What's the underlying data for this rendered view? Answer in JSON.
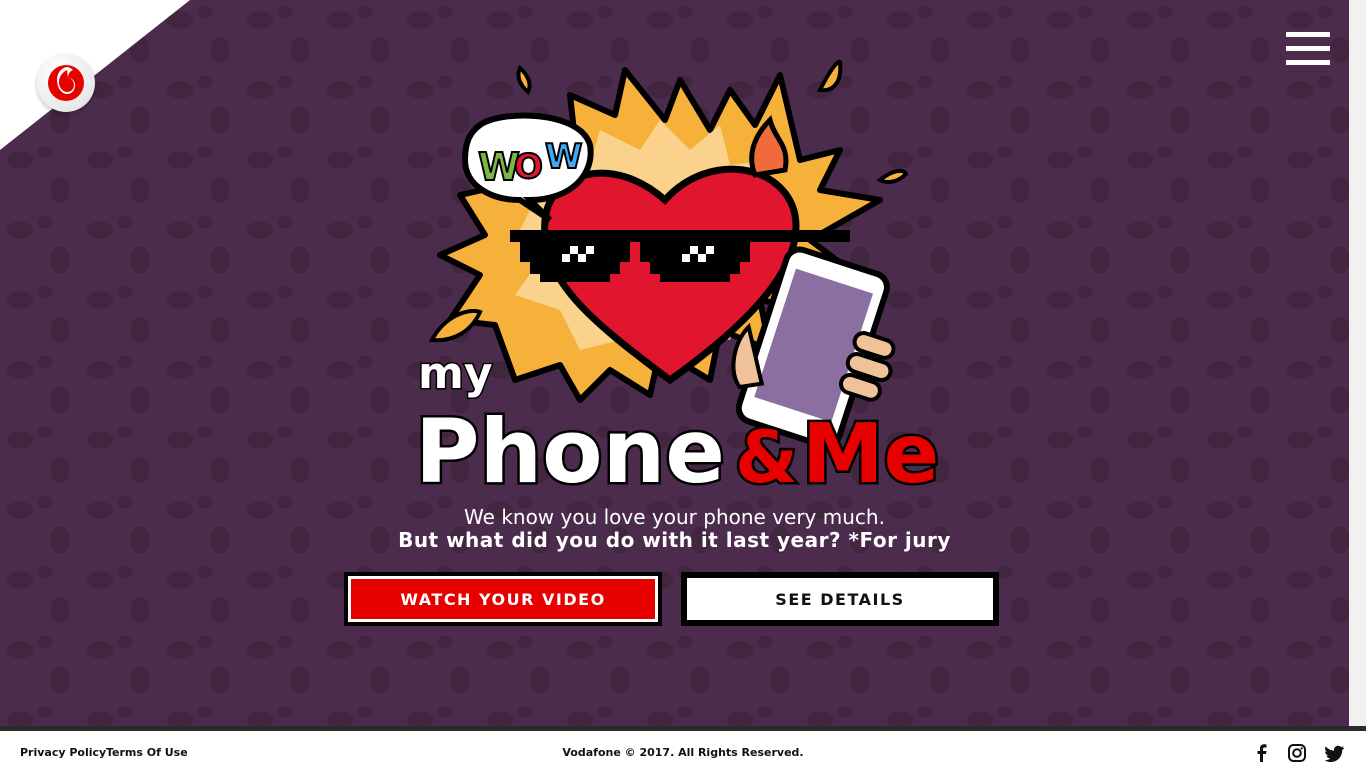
{
  "brand": {
    "name": "Vodafone"
  },
  "header": {
    "menu_icon": "hamburger-menu-icon"
  },
  "hero": {
    "bubble_text": "WOW",
    "title_my": "my",
    "title_phone": "Phone",
    "title_amp": "&",
    "title_me": "Me",
    "tagline_line1": "We know you love your phone very much.",
    "tagline_line2": "But what did you do with it last year? *For jury"
  },
  "actions": {
    "watch_label": "WATCH YOUR VIDEO",
    "details_label": "SEE DETAILS"
  },
  "footer": {
    "privacy_label": "Privacy Policy",
    "terms_label": "Terms Of Use",
    "copyright": "Vodafone © 2017. All Rights Reserved.",
    "social_icons": [
      "facebook-icon",
      "instagram-icon",
      "twitter-icon"
    ]
  },
  "colors": {
    "background": "#4b2c4d",
    "accent_red": "#e60000",
    "heart_red": "#e2152f",
    "flame_orange": "#f5a623",
    "white": "#ffffff"
  }
}
